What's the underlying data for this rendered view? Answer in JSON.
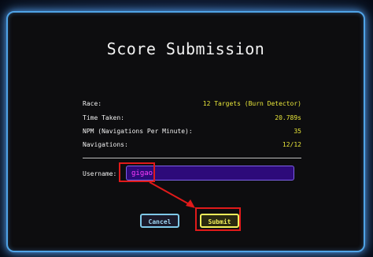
{
  "dialog": {
    "title": "Score Submission",
    "stats": [
      {
        "label": "Race:",
        "value": "12 Targets (Burn Detector)"
      },
      {
        "label": "Time Taken:",
        "value": "20.789s"
      },
      {
        "label": "NPM (Navigations Per Minute):",
        "value": "35"
      },
      {
        "label": "Navigations:",
        "value": "12/12"
      }
    ],
    "username_label": "Username:",
    "username_value": "gigao",
    "cancel_label": "Cancel",
    "submit_label": "Submit"
  },
  "colors": {
    "accent_glow": "#4fa3e6",
    "value_yellow": "#e8e63a",
    "input_bg": "#2d0a7a",
    "input_text": "#ff3cff",
    "annotation_red": "#e01a1a"
  }
}
